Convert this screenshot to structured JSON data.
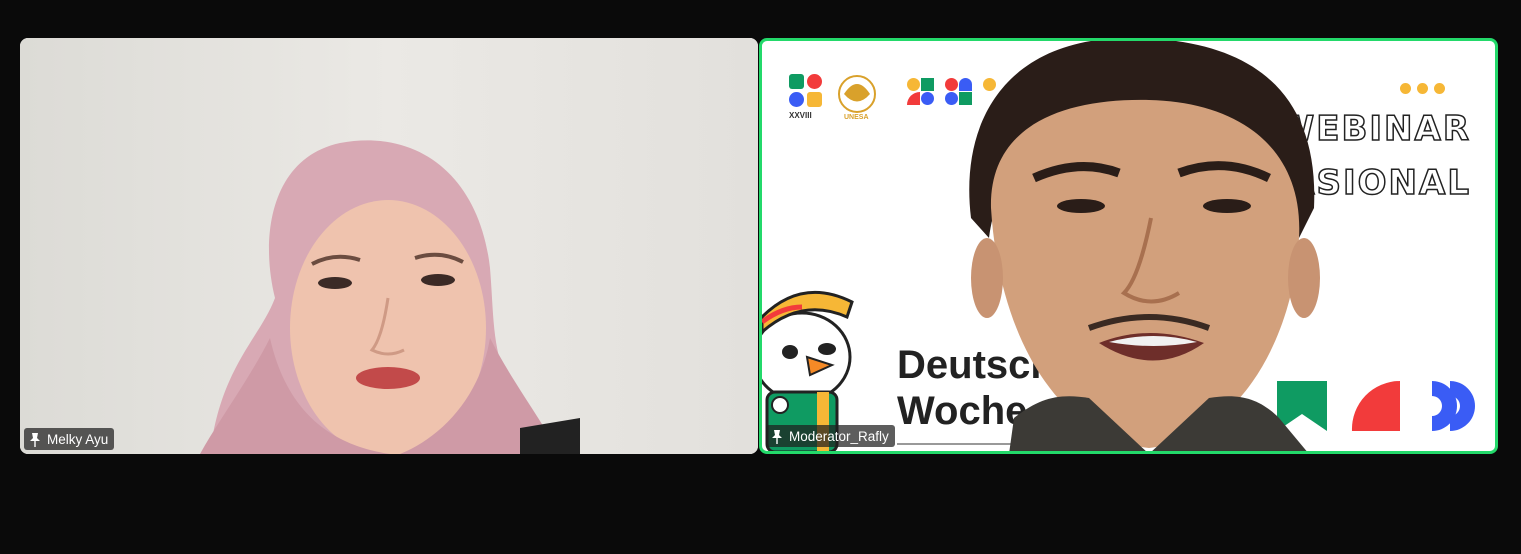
{
  "participants": [
    {
      "name": "Melky Ayu",
      "role": "speaker"
    },
    {
      "name": "Moderator_Rafly",
      "role": "active-speaker"
    }
  ],
  "slide": {
    "logo_text_left": "XXVIII",
    "logo_text_right": "UNESA",
    "headline_1": "WEBINAR",
    "headline_2": "ASIONAL",
    "event_line_1": "Deutsch",
    "event_line_2": "Woche"
  },
  "colors": {
    "active_speaker_border": "#23d96a",
    "accent_yellow": "#f6b736",
    "accent_green": "#0f9b62",
    "accent_red": "#f23b3b",
    "accent_blue": "#3a5cf5"
  },
  "icons": {
    "name_tag": "pin-icon"
  }
}
